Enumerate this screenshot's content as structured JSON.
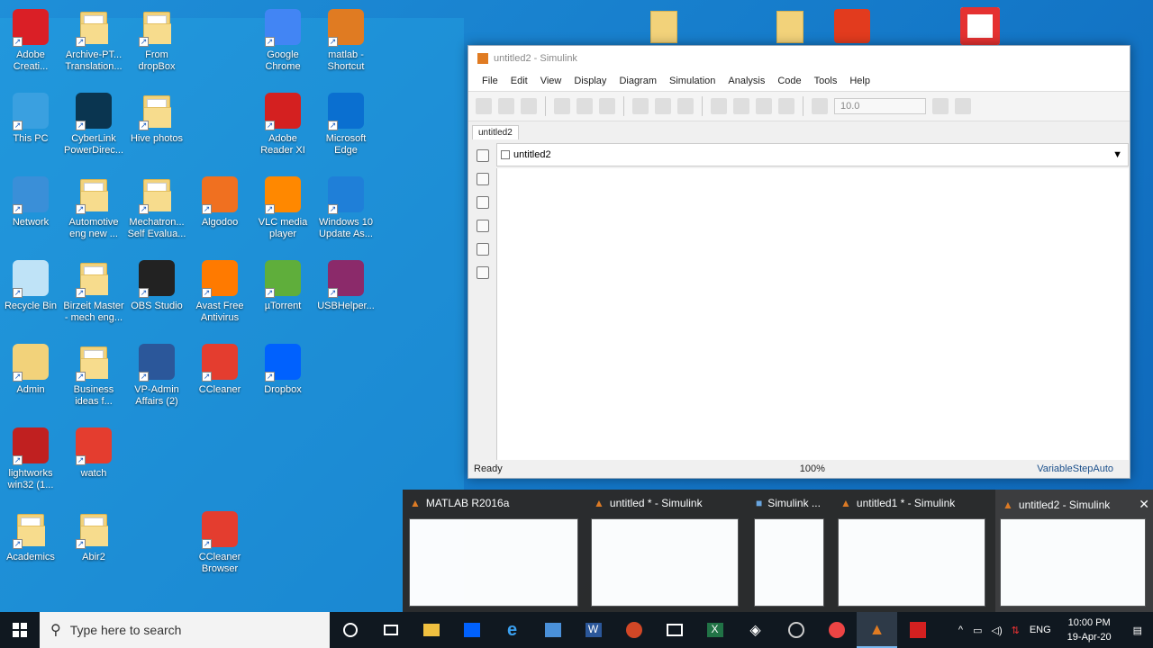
{
  "desktop": {
    "icons": [
      {
        "label": "Adobe\nCreati...",
        "icon": "adobe-cc-icon",
        "color": "#da1f26"
      },
      {
        "label": "Archive-PT...\nTranslation...",
        "icon": "folder-icon"
      },
      {
        "label": "From\ndropBox",
        "icon": "folder-icon"
      },
      {
        "label": "Google\nChrome",
        "icon": "chrome-icon"
      },
      {
        "label": "matlab -\nShortcut",
        "icon": "matlab-icon"
      },
      {
        "label": "This PC",
        "icon": "computer-icon"
      },
      {
        "label": "CyberLink\nPowerDirec...",
        "icon": "cyberlink-icon"
      },
      {
        "label": "Hive photos",
        "icon": "folder-icon"
      },
      {
        "label": "Adobe\nReader XI",
        "icon": "adobe-reader-icon"
      },
      {
        "label": "Microsoft\nEdge",
        "icon": "edge-icon"
      },
      {
        "label": "Network",
        "icon": "network-icon"
      },
      {
        "label": "Automotive\neng new ...",
        "icon": "folder-icon"
      },
      {
        "label": "Mechatron...\nSelf Evalua...",
        "icon": "folder-icon"
      },
      {
        "label": "Algodoo",
        "icon": "algodoo-icon"
      },
      {
        "label": "VLC media\nplayer",
        "icon": "vlc-icon"
      },
      {
        "label": "Windows 10\nUpdate As...",
        "icon": "windows-update-icon"
      },
      {
        "label": "Recycle Bin",
        "icon": "recycle-bin-icon"
      },
      {
        "label": "Birzeit Master\n- mech eng...",
        "icon": "folder-icon"
      },
      {
        "label": "OBS Studio",
        "icon": "obs-icon"
      },
      {
        "label": "Avast Free\nAntivirus",
        "icon": "avast-icon"
      },
      {
        "label": "µTorrent",
        "icon": "utorrent-icon"
      },
      {
        "label": "USBHelper...",
        "icon": "winrar-icon"
      },
      {
        "label": "Admin",
        "icon": "user-folder-icon"
      },
      {
        "label": "Business\nideas f...",
        "icon": "folder-icon"
      },
      {
        "label": "VP-Admin\nAffairs (2)",
        "icon": "word-doc-icon"
      },
      {
        "label": "CCleaner",
        "icon": "ccleaner-icon"
      },
      {
        "label": "lightworks\nwin32 (1...",
        "icon": "lightworks-icon"
      },
      {
        "label": "watch",
        "icon": "ccleaner-browser-icon"
      },
      {
        "label": "Dropbox",
        "icon": "dropbox-icon"
      },
      {
        "label": "Academics",
        "icon": "folder-icon"
      },
      {
        "label": "Abir2",
        "icon": "folder-icon"
      },
      {
        "label": "CCleaner\nBrowser",
        "icon": "ccleaner-browser-icon"
      }
    ]
  },
  "simulink": {
    "title": "untitled2 - Simulink",
    "menu": [
      "File",
      "Edit",
      "View",
      "Display",
      "Diagram",
      "Simulation",
      "Analysis",
      "Code",
      "Tools",
      "Help"
    ],
    "stop_time": "10.0",
    "tab": "untitled2",
    "address": "untitled2",
    "status_left": "Ready",
    "status_zoom": "100%",
    "status_solver": "VariableStepAuto"
  },
  "previews": [
    {
      "title": "MATLAB R2016a"
    },
    {
      "title": "untitled * - Simulink"
    },
    {
      "title": "Simulink ..."
    },
    {
      "title": "untitled1 * - Simulink"
    },
    {
      "title": "untitled2 - Simulink"
    }
  ],
  "taskbar": {
    "search_placeholder": "Type here to search",
    "lang": "ENG",
    "time": "10:00 PM",
    "date": "19-Apr-20"
  }
}
